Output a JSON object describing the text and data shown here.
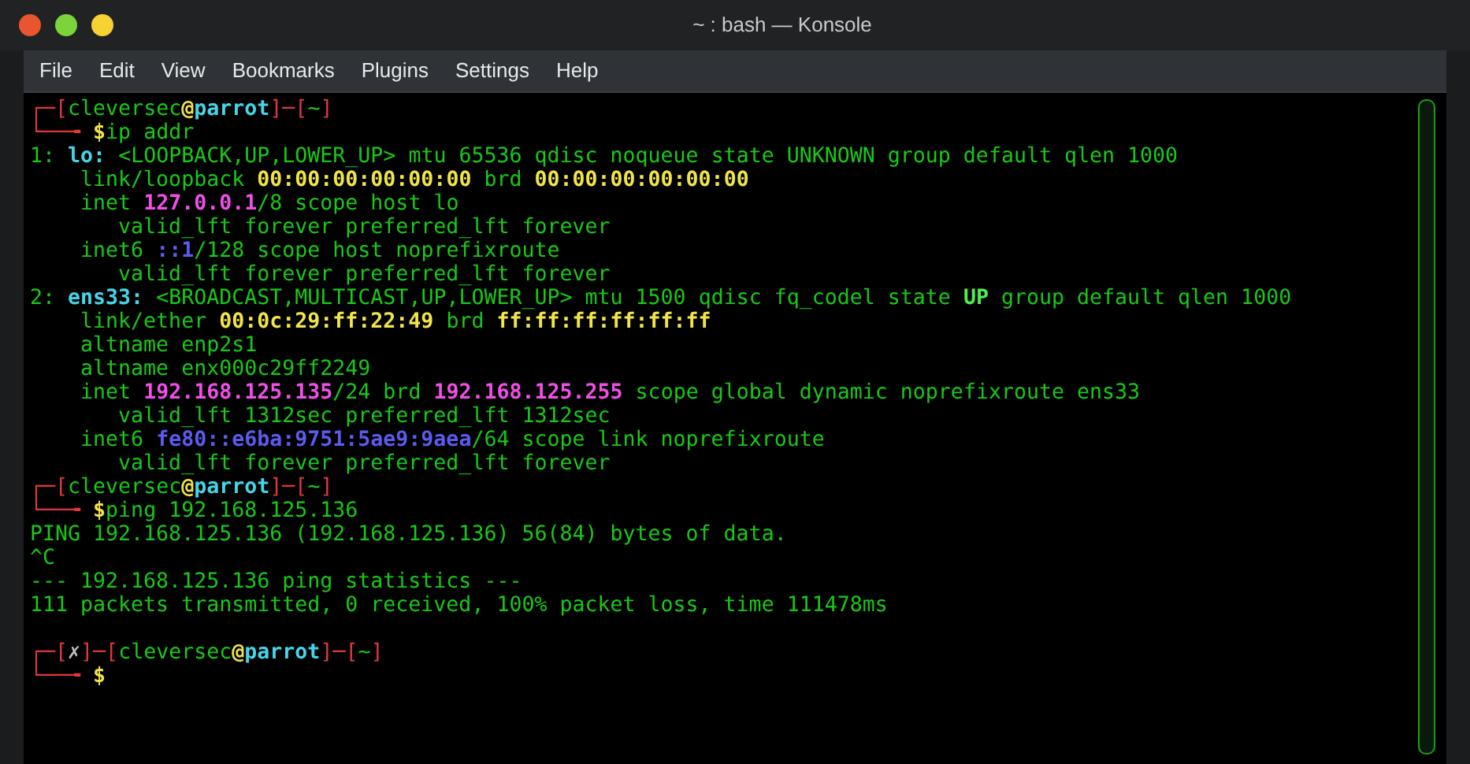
{
  "window": {
    "title": "~ : bash — Konsole"
  },
  "menu": [
    "File",
    "Edit",
    "View",
    "Bookmarks",
    "Plugins",
    "Settings",
    "Help"
  ],
  "terminal": {
    "lines": [
      {
        "kind": "text",
        "segments": [
          {
            "kind": "frame",
            "text": "┌─["
          },
          {
            "kind": "user",
            "text": "cleversec"
          },
          {
            "kind": "at",
            "text": "@"
          },
          {
            "kind": "host",
            "text": "parrot"
          },
          {
            "kind": "frame",
            "text": "]─["
          },
          {
            "kind": "path",
            "text": "~"
          },
          {
            "kind": "frame",
            "text": "]"
          }
        ]
      },
      {
        "kind": "text",
        "segments": [
          {
            "kind": "frame",
            "text": "└──╼ "
          },
          {
            "kind": "dollar",
            "text": "$"
          },
          {
            "kind": "plain",
            "text": "ip addr"
          }
        ]
      },
      {
        "kind": "text",
        "segments": [
          {
            "kind": "plain",
            "text": "1: "
          },
          {
            "kind": "iface",
            "text": "lo:"
          },
          {
            "kind": "plain",
            "text": " <LOOPBACK,UP,LOWER_UP> mtu 65536 qdisc noqueue state UNKNOWN group default qlen 1000"
          }
        ]
      },
      {
        "kind": "text",
        "segments": [
          {
            "kind": "plain",
            "text": "    link/loopback "
          },
          {
            "kind": "mac",
            "text": "00:00:00:00:00:00"
          },
          {
            "kind": "plain",
            "text": " brd "
          },
          {
            "kind": "mac",
            "text": "00:00:00:00:00:00"
          }
        ]
      },
      {
        "kind": "text",
        "segments": [
          {
            "kind": "plain",
            "text": "    inet "
          },
          {
            "kind": "ipv4",
            "text": "127.0.0.1"
          },
          {
            "kind": "plain",
            "text": "/8 scope host lo"
          }
        ]
      },
      {
        "kind": "text",
        "segments": [
          {
            "kind": "plain",
            "text": "       valid_lft forever preferred_lft forever"
          }
        ]
      },
      {
        "kind": "text",
        "segments": [
          {
            "kind": "plain",
            "text": "    inet6 "
          },
          {
            "kind": "ipv6",
            "text": "::1"
          },
          {
            "kind": "plain",
            "text": "/128 scope host noprefixroute"
          }
        ]
      },
      {
        "kind": "text",
        "segments": [
          {
            "kind": "plain",
            "text": "       valid_lft forever preferred_lft forever"
          }
        ]
      },
      {
        "kind": "text",
        "segments": [
          {
            "kind": "plain",
            "text": "2: "
          },
          {
            "kind": "iface",
            "text": "ens33:"
          },
          {
            "kind": "plain",
            "text": " <BROADCAST,MULTICAST,UP,LOWER_UP> mtu 1500 qdisc fq_codel state "
          },
          {
            "kind": "state",
            "text": "UP"
          },
          {
            "kind": "plain",
            "text": " group default qlen 1000"
          }
        ]
      },
      {
        "kind": "text",
        "segments": [
          {
            "kind": "plain",
            "text": "    link/ether "
          },
          {
            "kind": "mac",
            "text": "00:0c:29:ff:22:49"
          },
          {
            "kind": "plain",
            "text": " brd "
          },
          {
            "kind": "mac",
            "text": "ff:ff:ff:ff:ff:ff"
          }
        ]
      },
      {
        "kind": "text",
        "segments": [
          {
            "kind": "plain",
            "text": "    altname enp2s1"
          }
        ]
      },
      {
        "kind": "text",
        "segments": [
          {
            "kind": "plain",
            "text": "    altname enx000c29ff2249"
          }
        ]
      },
      {
        "kind": "text",
        "segments": [
          {
            "kind": "plain",
            "text": "    inet "
          },
          {
            "kind": "ipv4",
            "text": "192.168.125.135"
          },
          {
            "kind": "plain",
            "text": "/24 brd "
          },
          {
            "kind": "ipv4",
            "text": "192.168.125.255"
          },
          {
            "kind": "plain",
            "text": " scope global dynamic noprefixroute ens33"
          }
        ]
      },
      {
        "kind": "text",
        "segments": [
          {
            "kind": "plain",
            "text": "       valid_lft 1312sec preferred_lft 1312sec"
          }
        ]
      },
      {
        "kind": "text",
        "segments": [
          {
            "kind": "plain",
            "text": "    inet6 "
          },
          {
            "kind": "ipv6",
            "text": "fe80::e6ba:9751:5ae9:9aea"
          },
          {
            "kind": "plain",
            "text": "/64 scope link noprefixroute"
          }
        ]
      },
      {
        "kind": "text",
        "segments": [
          {
            "kind": "plain",
            "text": "       valid_lft forever preferred_lft forever"
          }
        ]
      },
      {
        "kind": "text",
        "segments": [
          {
            "kind": "frame",
            "text": "┌─["
          },
          {
            "kind": "user",
            "text": "cleversec"
          },
          {
            "kind": "at",
            "text": "@"
          },
          {
            "kind": "host",
            "text": "parrot"
          },
          {
            "kind": "frame",
            "text": "]─["
          },
          {
            "kind": "path",
            "text": "~"
          },
          {
            "kind": "frame",
            "text": "]"
          }
        ]
      },
      {
        "kind": "text",
        "segments": [
          {
            "kind": "frame",
            "text": "└──╼ "
          },
          {
            "kind": "dollar",
            "text": "$"
          },
          {
            "kind": "plain",
            "text": "ping 192.168.125.136"
          }
        ]
      },
      {
        "kind": "text",
        "segments": [
          {
            "kind": "plain",
            "text": "PING 192.168.125.136 (192.168.125.136) 56(84) bytes of data."
          }
        ]
      },
      {
        "kind": "text",
        "segments": [
          {
            "kind": "plain",
            "text": "^C"
          }
        ]
      },
      {
        "kind": "text",
        "segments": [
          {
            "kind": "plain",
            "text": "--- 192.168.125.136 ping statistics ---"
          }
        ]
      },
      {
        "kind": "text",
        "segments": [
          {
            "kind": "plain",
            "text": "111 packets transmitted, 0 received, 100% packet loss, time 111478ms"
          }
        ]
      },
      {
        "kind": "blank"
      },
      {
        "kind": "text",
        "segments": [
          {
            "kind": "frame",
            "text": "┌─["
          },
          {
            "kind": "fail",
            "text": "✗"
          },
          {
            "kind": "frame",
            "text": "]─["
          },
          {
            "kind": "user",
            "text": "cleversec"
          },
          {
            "kind": "at",
            "text": "@"
          },
          {
            "kind": "host",
            "text": "parrot"
          },
          {
            "kind": "frame",
            "text": "]─["
          },
          {
            "kind": "path",
            "text": "~"
          },
          {
            "kind": "frame",
            "text": "]"
          }
        ]
      },
      {
        "kind": "text",
        "segments": [
          {
            "kind": "frame",
            "text": "└──╼ "
          },
          {
            "kind": "dollar",
            "text": "$"
          }
        ]
      }
    ]
  }
}
